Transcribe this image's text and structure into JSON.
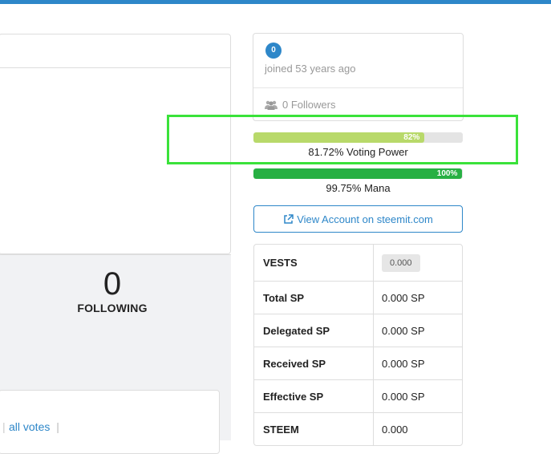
{
  "profile": {
    "reputation": "0",
    "joined": "joined 53 years ago",
    "followers": "0 Followers"
  },
  "stats": {
    "following_count": "0",
    "following_label": "FOLLOWING"
  },
  "votes": {
    "all_votes_link": "all votes"
  },
  "voting_power": {
    "fill_percent": 81.72,
    "bar_label": "82%",
    "text": "81.72% Voting Power",
    "color": "#b8d96a"
  },
  "mana": {
    "fill_percent": 99.75,
    "bar_label": "100%",
    "text": "99.75% Mana",
    "color": "#27b043"
  },
  "account_button": "View Account on steemit.com",
  "account_table": [
    {
      "key": "VESTS",
      "value": "0.000",
      "badge": true
    },
    {
      "key": "Total SP",
      "value": "0.000 SP"
    },
    {
      "key": "Delegated SP",
      "value": "0.000 SP"
    },
    {
      "key": "Received SP",
      "value": "0.000 SP"
    },
    {
      "key": "Effective SP",
      "value": "0.000 SP"
    },
    {
      "key": "STEEM",
      "value": "0.000"
    }
  ],
  "colors": {
    "accent": "#2e87c9",
    "highlight": "#3ae23a"
  }
}
